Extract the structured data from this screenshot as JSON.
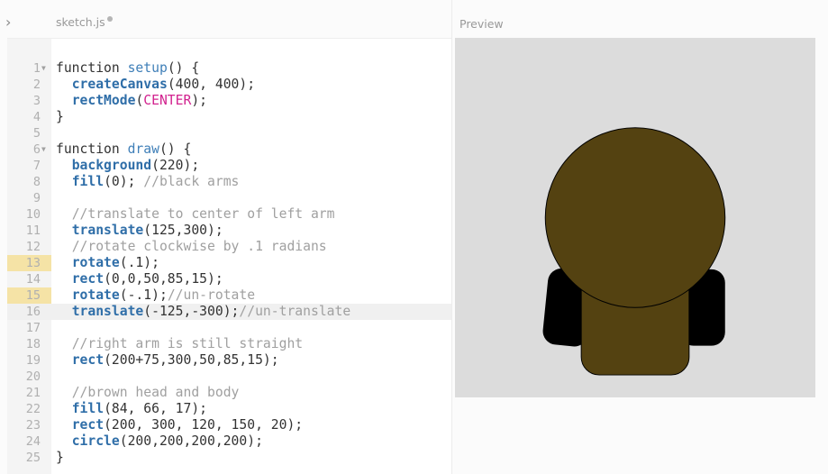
{
  "editor": {
    "file_name": "sketch.js",
    "unsaved": true,
    "lines": [
      {
        "n": "1",
        "fold": true,
        "tokens": [
          [
            "k",
            "function "
          ],
          [
            "fn",
            "setup"
          ],
          [
            "p",
            "() {"
          ]
        ]
      },
      {
        "n": "2",
        "tokens": [
          [
            "p",
            "  "
          ],
          [
            "b",
            "createCanvas"
          ],
          [
            "p",
            "(400, 400);"
          ]
        ]
      },
      {
        "n": "3",
        "tokens": [
          [
            "p",
            "  "
          ],
          [
            "b",
            "rectMode"
          ],
          [
            "p",
            "("
          ],
          [
            "m",
            "CENTER"
          ],
          [
            "p",
            ");"
          ]
        ]
      },
      {
        "n": "4",
        "tokens": [
          [
            "p",
            "}"
          ]
        ]
      },
      {
        "n": "5",
        "tokens": []
      },
      {
        "n": "6",
        "fold": true,
        "tokens": [
          [
            "k",
            "function "
          ],
          [
            "fn",
            "draw"
          ],
          [
            "p",
            "() {"
          ]
        ]
      },
      {
        "n": "7",
        "tokens": [
          [
            "p",
            "  "
          ],
          [
            "b",
            "background"
          ],
          [
            "p",
            "(220);"
          ]
        ]
      },
      {
        "n": "8",
        "tokens": [
          [
            "p",
            "  "
          ],
          [
            "b",
            "fill"
          ],
          [
            "p",
            "(0); "
          ],
          [
            "c",
            "//black arms"
          ]
        ]
      },
      {
        "n": "9",
        "tokens": []
      },
      {
        "n": "10",
        "tokens": [
          [
            "p",
            "  "
          ],
          [
            "c",
            "//translate to center of left arm"
          ]
        ]
      },
      {
        "n": "11",
        "tokens": [
          [
            "p",
            "  "
          ],
          [
            "b",
            "translate"
          ],
          [
            "p",
            "(125,300);"
          ]
        ]
      },
      {
        "n": "12",
        "tokens": [
          [
            "p",
            "  "
          ],
          [
            "c",
            "//rotate clockwise by .1 radians"
          ]
        ]
      },
      {
        "n": "13",
        "highlight": true,
        "tokens": [
          [
            "p",
            "  "
          ],
          [
            "b",
            "rotate"
          ],
          [
            "p",
            "(.1);"
          ]
        ]
      },
      {
        "n": "14",
        "tokens": [
          [
            "p",
            "  "
          ],
          [
            "b",
            "rect"
          ],
          [
            "p",
            "(0,0,50,85,15);"
          ]
        ]
      },
      {
        "n": "15",
        "highlight": true,
        "tokens": [
          [
            "p",
            "  "
          ],
          [
            "b",
            "rotate"
          ],
          [
            "p",
            "(-.1);"
          ],
          [
            "c",
            "//un-rotate"
          ]
        ]
      },
      {
        "n": "16",
        "active": true,
        "tokens": [
          [
            "p",
            "  "
          ],
          [
            "b",
            "translate"
          ],
          [
            "p",
            "(-125,-300);"
          ],
          [
            "c",
            "//un-translate"
          ]
        ]
      },
      {
        "n": "17",
        "tokens": []
      },
      {
        "n": "18",
        "tokens": [
          [
            "p",
            "  "
          ],
          [
            "c",
            "//right arm is still straight"
          ]
        ]
      },
      {
        "n": "19",
        "tokens": [
          [
            "p",
            "  "
          ],
          [
            "b",
            "rect"
          ],
          [
            "p",
            "(200+75,300,50,85,15);"
          ]
        ]
      },
      {
        "n": "20",
        "tokens": []
      },
      {
        "n": "21",
        "tokens": [
          [
            "p",
            "  "
          ],
          [
            "c",
            "//brown head and body"
          ]
        ]
      },
      {
        "n": "22",
        "tokens": [
          [
            "p",
            "  "
          ],
          [
            "b",
            "fill"
          ],
          [
            "p",
            "(84, 66, 17);"
          ]
        ]
      },
      {
        "n": "23",
        "tokens": [
          [
            "p",
            "  "
          ],
          [
            "b",
            "rect"
          ],
          [
            "p",
            "(200, 300, 120, 150, 20);"
          ]
        ]
      },
      {
        "n": "24",
        "tokens": [
          [
            "p",
            "  "
          ],
          [
            "b",
            "circle"
          ],
          [
            "p",
            "(200,200,200,200);"
          ]
        ]
      },
      {
        "n": "25",
        "tokens": [
          [
            "p",
            "}"
          ]
        ]
      }
    ]
  },
  "preview": {
    "label": "Preview",
    "background_color": "#dcdcdc",
    "body_color": "#544211",
    "arm_color": "#000000"
  },
  "icons": {
    "sidebar_toggle": "chevron-right-icon",
    "fold_marker": "fold-triangle-icon"
  }
}
